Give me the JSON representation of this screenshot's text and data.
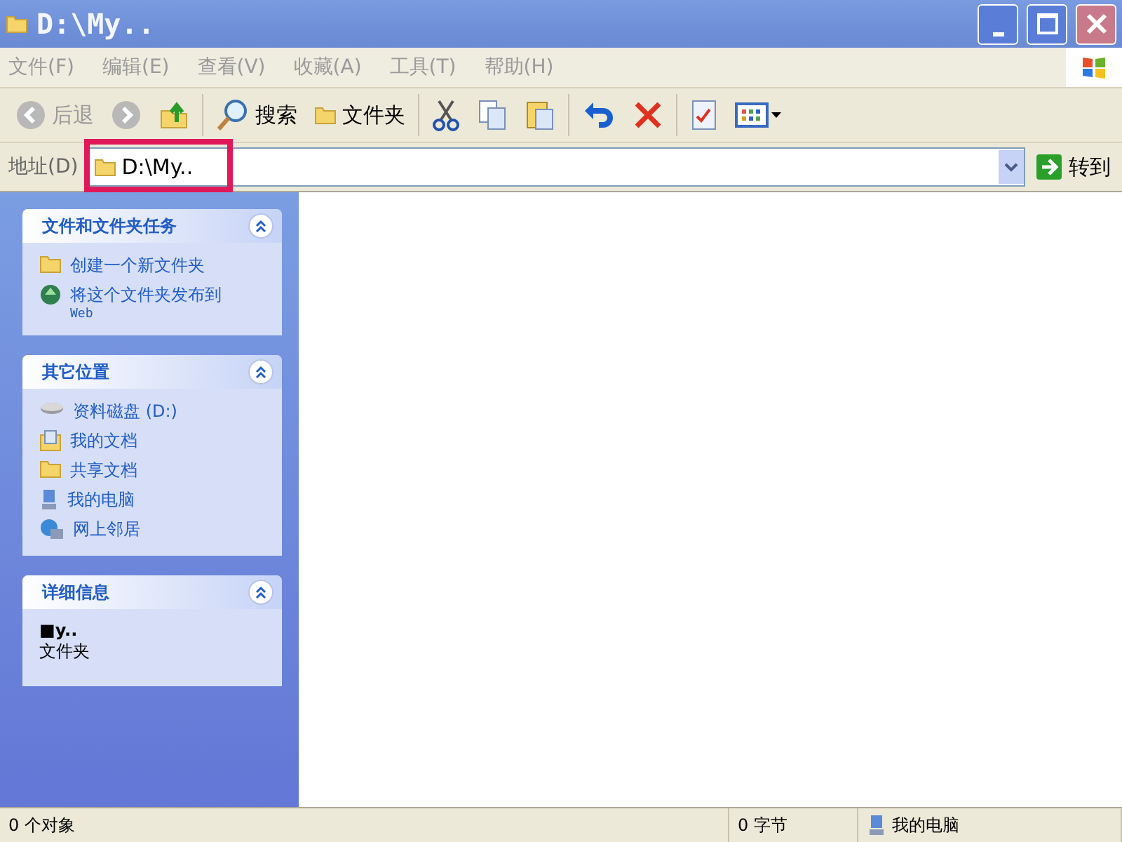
{
  "window": {
    "title": "D:\\My.."
  },
  "menu": [
    "文件(F)",
    "编辑(E)",
    "查看(V)",
    "收藏(A)",
    "工具(T)",
    "帮助(H)"
  ],
  "toolbar": [
    {
      "kind": "back",
      "label": "后退",
      "disabled": true
    },
    {
      "kind": "forward",
      "disabled": true
    },
    {
      "kind": "up"
    },
    {
      "kind": "search",
      "label": "搜索"
    },
    {
      "kind": "folders",
      "label": "文件夹"
    },
    {
      "kind": "cut"
    },
    {
      "kind": "copy"
    },
    {
      "kind": "paste"
    },
    {
      "kind": "undo"
    },
    {
      "kind": "delete"
    },
    {
      "kind": "properties"
    },
    {
      "kind": "views"
    }
  ],
  "address": {
    "label": "地址(D)",
    "value": "D:\\My..",
    "go": "转到"
  },
  "panels": [
    {
      "title": "文件和文件夹任务",
      "items": [
        {
          "kind": "new-folder",
          "label": "创建一个新文件夹"
        },
        {
          "kind": "publish",
          "label": "将这个文件夹发布到",
          "sub": "Web"
        }
      ]
    },
    {
      "title": "其它位置",
      "items": [
        {
          "kind": "drive",
          "label": "资料磁盘 (D:)"
        },
        {
          "kind": "documents",
          "label": "我的文档"
        },
        {
          "kind": "folder",
          "label": "共享文档"
        },
        {
          "kind": "computer",
          "label": "我的电脑"
        },
        {
          "kind": "network",
          "label": "网上邻居"
        }
      ]
    }
  ],
  "details": {
    "title": "详细信息",
    "name": "■y..",
    "type": "文件夹"
  },
  "status": [
    "0 个对象",
    "0 字节",
    "我的电脑"
  ]
}
